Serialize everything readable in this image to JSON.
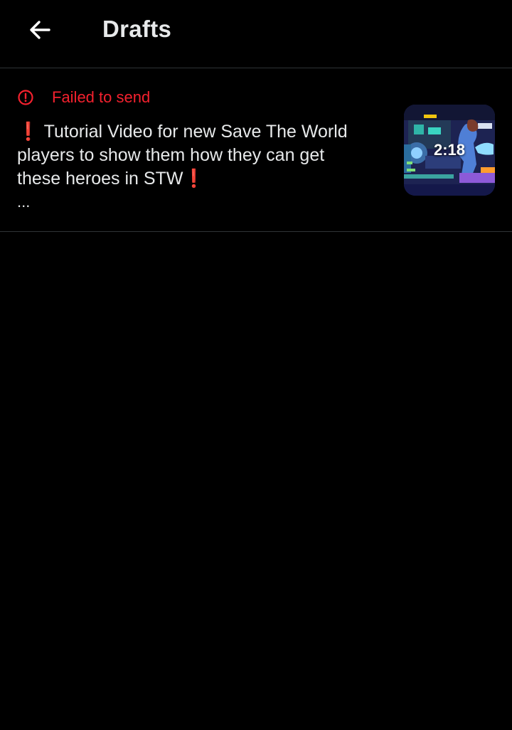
{
  "header": {
    "title": "Drafts",
    "back_icon": "arrow-left-icon"
  },
  "draft": {
    "status": "Failed to send",
    "status_icon": "alert-circle-icon",
    "text": "❗ Tutorial Video for new Save The World players to show them how they can get these heroes in STW❗",
    "truncation": "...",
    "thumbnail": {
      "duration": "2:18",
      "type": "video"
    }
  },
  "colors": {
    "background": "#000000",
    "error": "#f4212e",
    "text": "#e7e9ea",
    "divider": "#2f3336"
  }
}
